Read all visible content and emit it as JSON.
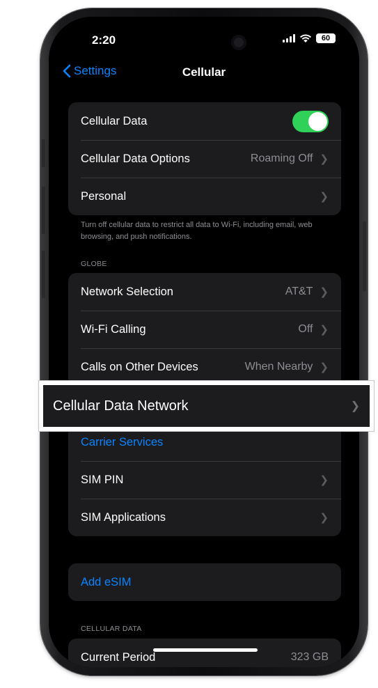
{
  "status": {
    "time": "2:20",
    "battery": "60"
  },
  "nav": {
    "back_label": "Settings",
    "title": "Cellular"
  },
  "group1": {
    "cellular_data_label": "Cellular Data",
    "cellular_data_on": true,
    "options_label": "Cellular Data Options",
    "options_value": "Roaming Off",
    "personal_label": "Personal"
  },
  "footnote": "Turn off cellular data to restrict all data to Wi-Fi, including email, web browsing, and push notifications.",
  "section_globe": "GLOBE",
  "group2": {
    "rows": [
      {
        "label": "Network Selection",
        "value": "AT&T"
      },
      {
        "label": "Wi-Fi Calling",
        "value": "Off"
      },
      {
        "label": "Calls on Other Devices",
        "value": "When Nearby"
      }
    ],
    "carrier_services": "Carrier Services",
    "sim_pin": "SIM PIN",
    "sim_applications": "SIM Applications"
  },
  "add_esim": "Add eSIM",
  "section_cellular_data": "CELLULAR DATA",
  "current_period": {
    "label": "Current Period",
    "value": "323 GB"
  },
  "highlight": {
    "label": "Cellular Data Network"
  },
  "colors": {
    "accent": "#0a84ff",
    "toggle_on": "#30d158",
    "group_bg": "#1c1c1e"
  }
}
